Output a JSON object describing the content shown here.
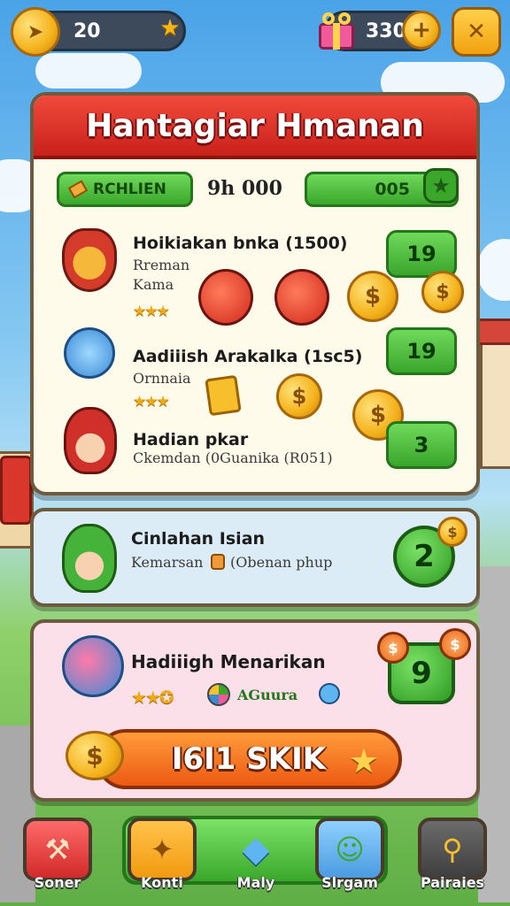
{
  "top_bar": {
    "left_count": "20",
    "right_count": "330",
    "close_symbol": "✕",
    "plus_symbol": "+",
    "star_symbol": "★",
    "arrow_symbol": "➤"
  },
  "panel": {
    "title": "Hantagiar Hmanan",
    "left_bar_label": "RCHLIEN",
    "middle_value": "9h 000",
    "right_bar_value": "005",
    "rows": [
      {
        "title": "Hoikiakan bnka (1500)",
        "sub1": "Rreman",
        "sub2": "Kama",
        "button": "19"
      },
      {
        "title": "Aadiiish Arakalka (1sc5)",
        "sub1": "Ornnaia",
        "button": "19"
      },
      {
        "title": "Hadian pkar",
        "sub1": "Ckemdan (0Guanika (R051)",
        "button": "3"
      }
    ]
  },
  "card_blue": {
    "title": "Cinlahan Isian",
    "sub": "Kemarsan",
    "sub_extra": "(Obenan phup",
    "badge": "2"
  },
  "card_pink": {
    "title": "Hadiiigh Menarikan",
    "sub": "AGuura",
    "badge": "9",
    "cta": "I6I1 SKIK"
  },
  "bottom_nav": [
    {
      "label": "Soner",
      "icon": "hammer-icon"
    },
    {
      "label": "Konti",
      "icon": "puzzle-icon"
    },
    {
      "label": "Maly",
      "icon": "gem-icon"
    },
    {
      "label": "Slrgam",
      "icon": "character-icon"
    },
    {
      "label": "Pairaies",
      "icon": "magnifier-icon"
    }
  ],
  "colors": {
    "header_red": "#e0342a",
    "button_green": "#4cbf3a",
    "cta_orange": "#f57a22",
    "card_blue": "#dcecf7",
    "card_pink": "#fbe0ea"
  }
}
